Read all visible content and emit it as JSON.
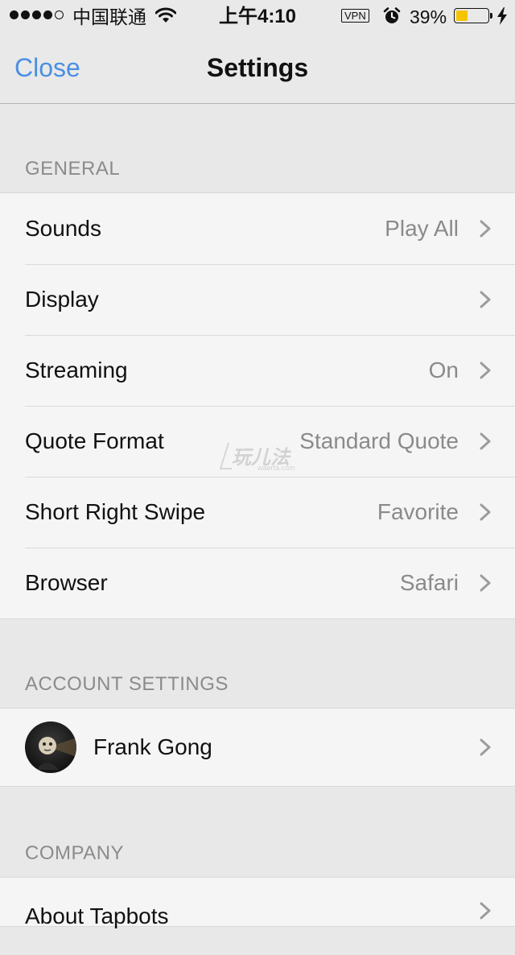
{
  "status_bar": {
    "carrier": "中国联通",
    "time": "上午4:10",
    "vpn": "VPN",
    "battery_percent": "39%",
    "battery_level": 0.39,
    "battery_color": "#f5c400"
  },
  "nav": {
    "close_label": "Close",
    "title": "Settings",
    "accent_color": "#4a90e2"
  },
  "sections": {
    "general": {
      "header": "GENERAL",
      "rows": [
        {
          "label": "Sounds",
          "value": "Play All"
        },
        {
          "label": "Display",
          "value": ""
        },
        {
          "label": "Streaming",
          "value": "On"
        },
        {
          "label": "Quote Format",
          "value": "Standard Quote"
        },
        {
          "label": "Short Right Swipe",
          "value": "Favorite"
        },
        {
          "label": "Browser",
          "value": "Safari"
        }
      ]
    },
    "account": {
      "header": "ACCOUNT SETTINGS",
      "user_name": "Frank Gong"
    },
    "company": {
      "header": "COMPANY",
      "first_row_label": "About Tapbots"
    }
  },
  "watermark": {
    "text": "玩儿法",
    "sub": "waerfa.com"
  },
  "icons": {
    "wifi": "wifi-icon",
    "alarm": "alarm-clock-icon",
    "charging": "charging-bolt-icon",
    "chevron": "chevron-right-icon"
  }
}
